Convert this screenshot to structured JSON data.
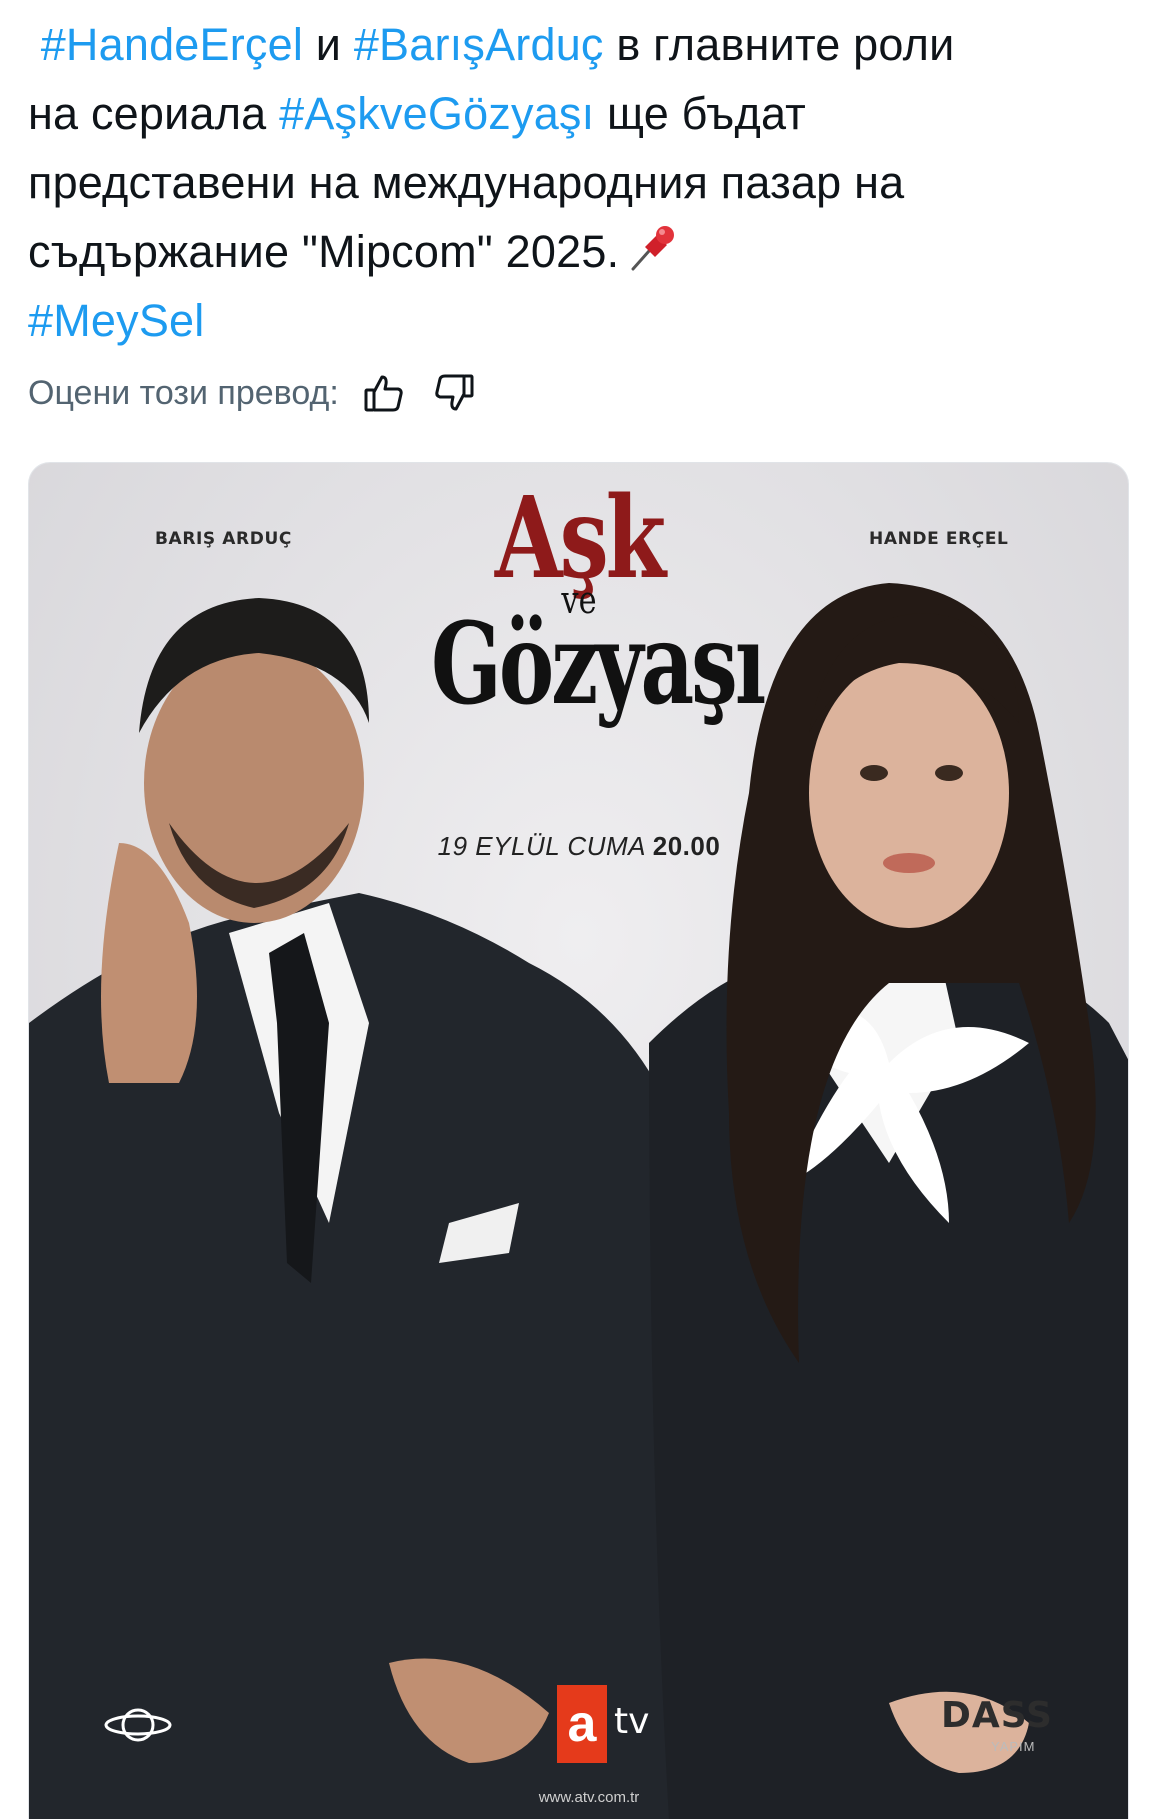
{
  "tweet": {
    "hashtag_1": "#HandeErçel",
    "word_i": "и",
    "hashtag_2": "#BarışArduç",
    "text_1": "в главните роли",
    "text_2": "на сериала",
    "hashtag_3": "#AşkveGözyaşı",
    "text_3": "ще бъдат",
    "text_4": "представени на международния пазар на",
    "text_5": "съдържание \"Mipcom\" 2025.",
    "hashtag_4": "#MeySel"
  },
  "translation_rating": {
    "label": "Оцени този превод:"
  },
  "poster": {
    "actor_left": "BARIŞ ARDUÇ",
    "actor_right": "HANDE ERÇEL",
    "title_top": "Aşk",
    "title_mid": "ve",
    "title_bottom": "Gözyaşı",
    "date_text": "19 EYLÜL CUMA",
    "time_text": "20.00",
    "channel_letter": "a",
    "channel_suffix": "tv",
    "producer": "DASS",
    "producer_sub": "YAPIM",
    "website": "www.atv.com.tr"
  },
  "colors": {
    "link": "#1d9bf0",
    "text": "#0f1419",
    "muted": "#536471",
    "title_red": "#8e1a1a",
    "atv_red": "#e53a1b"
  }
}
